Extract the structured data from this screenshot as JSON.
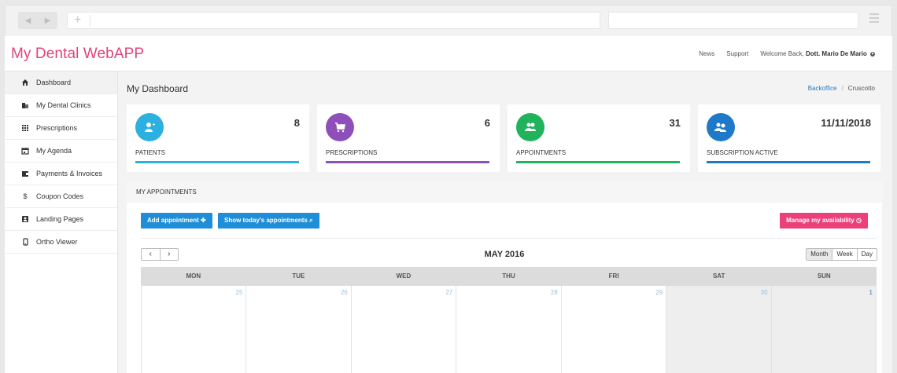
{
  "app": {
    "brand": "My Dental WebAPP",
    "topnav": {
      "news": "News",
      "support": "Support",
      "welcome_prefix": "Welcome Back,",
      "user_name": "Dott. Mario De Mario"
    },
    "colors": {
      "brand": "#e0447a",
      "patients": "#2bb0e0",
      "prescriptions": "#8e4fb8",
      "appointments": "#20b35b",
      "subscription": "#1e7ac8",
      "add_button": "#1e8ed8",
      "manage_button": "#ec407a"
    }
  },
  "sidebar": {
    "items": [
      {
        "label": "Dashboard",
        "icon": "home-icon"
      },
      {
        "label": "My Dental Clinics",
        "icon": "building-icon"
      },
      {
        "label": "Prescriptions",
        "icon": "grid-icon"
      },
      {
        "label": "My Agenda",
        "icon": "calendar-icon"
      },
      {
        "label": "Payments & Invoices",
        "icon": "wallet-icon"
      },
      {
        "label": "Coupon Codes",
        "icon": "dollar-icon"
      },
      {
        "label": "Landing Pages",
        "icon": "contact-card-icon"
      },
      {
        "label": "Ortho Viewer",
        "icon": "mobile-icon"
      }
    ]
  },
  "main": {
    "title": "My Dashboard",
    "breadcrumb": {
      "link": "Backoffice",
      "current": "Cruscotto"
    },
    "cards": [
      {
        "label": "PATIENTS",
        "value": "8",
        "icon": "user-plus-icon"
      },
      {
        "label": "PRESCRIPTIONS",
        "value": "6",
        "icon": "cart-icon"
      },
      {
        "label": "APPOINTMENTS",
        "value": "31",
        "icon": "users-icon"
      },
      {
        "label": "SUBSCRIPTION ACTIVE",
        "value": "11/11/2018",
        "icon": "user-group-icon"
      }
    ],
    "appointments": {
      "header": "MY APPOINTMENTS",
      "add_button": "Add appointment",
      "today_button": "Show today's appointments",
      "manage_button": "Manage my availability",
      "month_title": "MAY 2016",
      "views": [
        "Month",
        "Week",
        "Day"
      ],
      "weekdays": [
        "MON",
        "TUE",
        "WED",
        "THU",
        "FRI",
        "SAT",
        "SUN"
      ],
      "first_row_dates": [
        "25",
        "26",
        "27",
        "28",
        "29",
        "30",
        "1"
      ]
    }
  }
}
